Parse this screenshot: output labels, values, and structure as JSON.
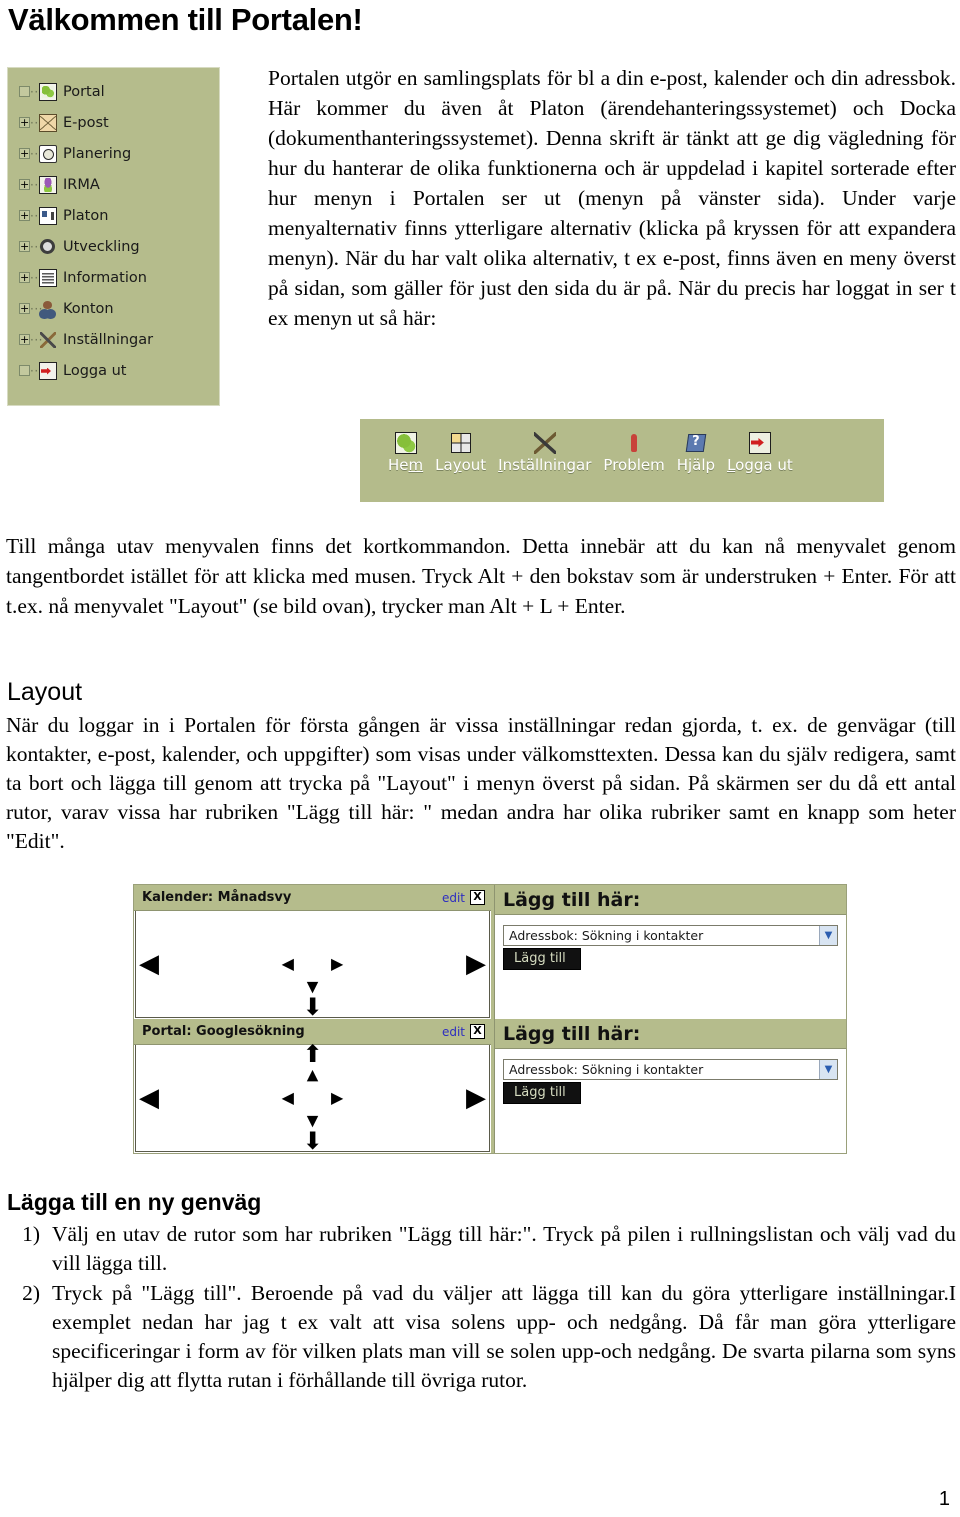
{
  "page_title": "Välkommen till Portalen!",
  "sidebar": {
    "items": [
      {
        "label": "Portal",
        "toggle": "none",
        "icon": "map-icon"
      },
      {
        "label": "E-post",
        "toggle": "plus",
        "icon": "mail-icon"
      },
      {
        "label": "Planering",
        "toggle": "plus",
        "icon": "clock-icon"
      },
      {
        "label": "IRMA",
        "toggle": "plus",
        "icon": "flower-icon"
      },
      {
        "label": "Platon",
        "toggle": "plus",
        "icon": "card-icon"
      },
      {
        "label": "Utveckling",
        "toggle": "plus",
        "icon": "gear-icon"
      },
      {
        "label": "Information",
        "toggle": "plus",
        "icon": "news-icon"
      },
      {
        "label": "Konton",
        "toggle": "plus",
        "icon": "user-icon"
      },
      {
        "label": "Inställningar",
        "toggle": "plus",
        "icon": "tools-icon"
      },
      {
        "label": "Logga ut",
        "toggle": "none",
        "icon": "logout-icon"
      }
    ]
  },
  "intro_paragraph": "Portalen utgör en samlingsplats för bl a din e-post, kalender och din adressbok. Här kommer du även åt Platon (ärendehanteringssystemet) och Docka (dokumenthanteringssystemet). Denna skrift är tänkt att ge dig vägledning för hur du hanterar de olika funktionerna och är uppdelad i kapitel sorterade efter hur menyn i Portalen ser ut (menyn på vänster sida). Under varje menyalternativ finns ytterligare alternativ (klicka på kryssen för att expandera menyn). När du har valt olika alternativ, t ex e-post, finns även en meny överst på sidan, som gäller för just den sida du är på. När du precis har loggat in ser t ex menyn ut så här:",
  "toolbar": {
    "items": [
      {
        "label_pre": "He",
        "accel": "m",
        "label_post": "",
        "icon": "home-icon"
      },
      {
        "label_pre": "La",
        "accel": "y",
        "label_post": "out",
        "icon": "layout-icon"
      },
      {
        "label_pre": "",
        "accel": "I",
        "label_post": "nställningar",
        "icon": "tools-icon"
      },
      {
        "label_pre": "Problem",
        "accel": "",
        "label_post": "",
        "icon": "problem-icon"
      },
      {
        "label_pre": "Hjälp",
        "accel": "",
        "label_post": "",
        "icon": "help-icon"
      },
      {
        "label_pre": "",
        "accel": "L",
        "label_post": "ogga ut",
        "icon": "logout-icon"
      }
    ]
  },
  "shortcut_paragraph": "Till många utav menyvalen finns det kortkommandon. Detta innebär att du kan nå menyvalet genom tangentbordet istället för att klicka med musen. Tryck Alt + den bokstav som är understruken + Enter.  För att t.ex. nå menyvalet \"Layout\" (se bild ovan), trycker man Alt + L + Enter.",
  "layout_section": {
    "heading": "Layout",
    "paragraph": "När du loggar in i Portalen för första gången är vissa inställningar redan gjorda, t. ex. de genvägar (till kontakter, e-post, kalender, och uppgifter) som visas under välkomsttexten. Dessa kan du själv redigera, samt ta bort och lägga till genom att trycka på \"Layout\" i menyn överst på sidan.  På skärmen ser du då ett antal rutor, varav vissa har rubriken \"Lägg till här: \" medan andra har olika rubriker samt en knapp som heter \"Edit\"."
  },
  "editor": {
    "rows": [
      {
        "panel_title": "Kalender: Månadsvy",
        "edit_label": "edit",
        "close_label": "X",
        "add_title": "Lägg till här:",
        "select_value": "Adressbok: Sökning i kontakter",
        "button_label": "Lägg till"
      },
      {
        "panel_title": "Portal: Googlesökning",
        "edit_label": "edit",
        "close_label": "X",
        "add_title": "Lägg till här:",
        "select_value": "Adressbok: Sökning i kontakter",
        "button_label": "Lägg till"
      }
    ]
  },
  "genvag_section": {
    "heading": "Lägga till en ny genväg",
    "steps": [
      {
        "num": "1)",
        "text": "Välj en utav de rutor som har rubriken \"Lägg till här:\". Tryck på pilen i rullningslistan och välj vad du vill lägga till."
      },
      {
        "num": "2)",
        "text": "Tryck på \"Lägg till\".  Beroende på vad du väljer att lägga till kan du göra ytterligare inställningar.I exemplet nedan har jag t ex valt att visa solens upp- och nedgång. Då får man göra ytterligare specificeringar i form av för vilken plats man vill se solen upp-och nedgång. De svarta pilarna som syns hjälper dig att flytta rutan i förhållande till övriga rutor."
      }
    ]
  },
  "page_number": "1",
  "colors": {
    "panel_olive": "#b5bc8c",
    "link_blue": "#2d2dc0",
    "button_black": "#111111"
  }
}
